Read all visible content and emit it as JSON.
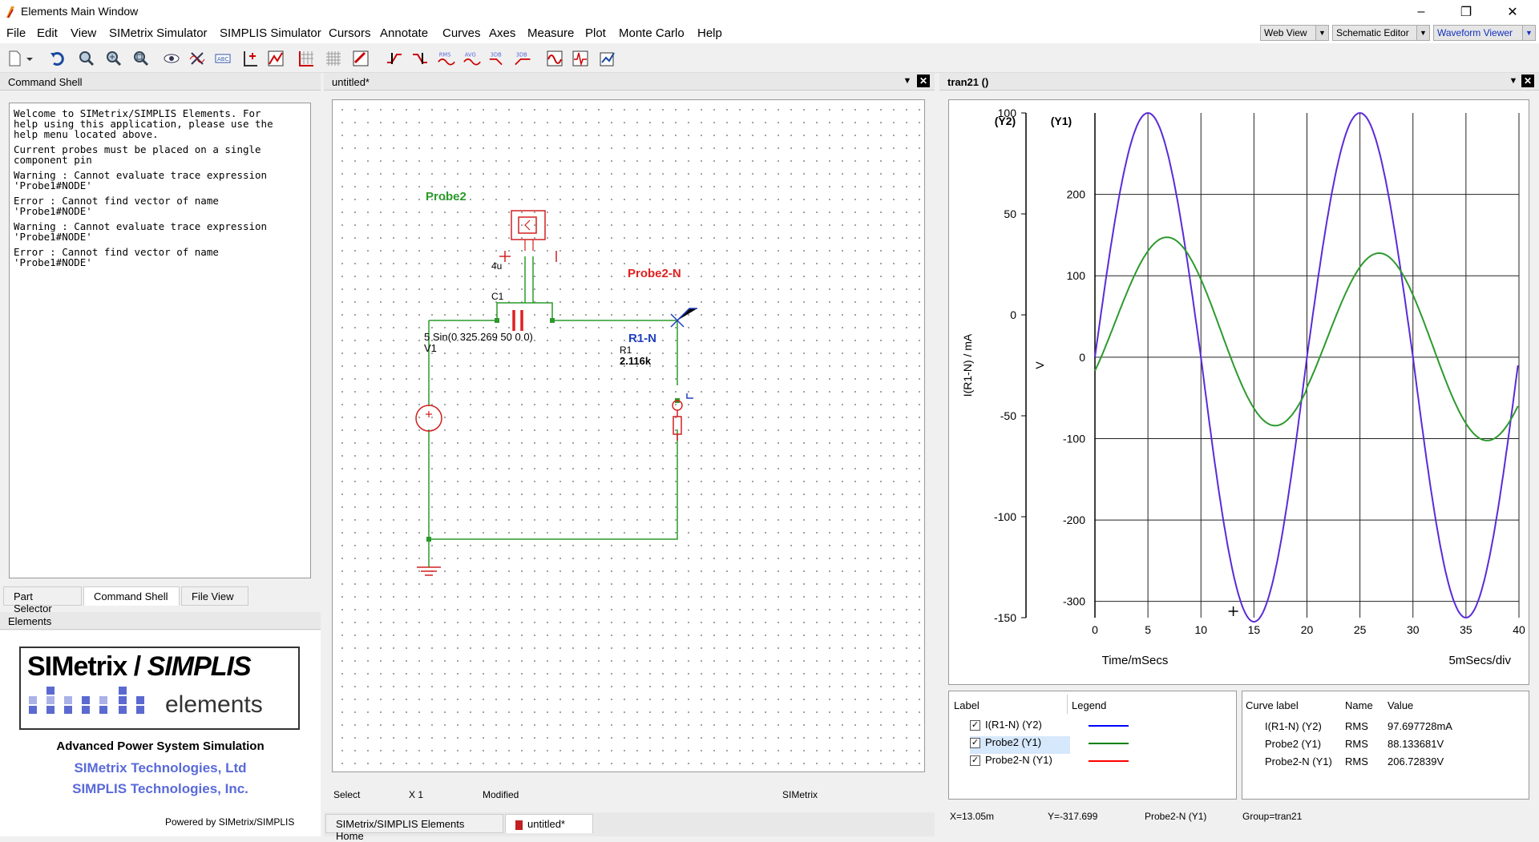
{
  "window": {
    "title": "Elements Main Window",
    "minimize": "–",
    "maximize": "❐",
    "close": "✕"
  },
  "menu": [
    "File",
    "Edit",
    "View",
    "SIMetrix Simulator",
    "SIMPLIS Simulator",
    "Cursors",
    "Annotate",
    "Curves",
    "Axes",
    "Measure",
    "Plot",
    "Monte Carlo",
    "Help"
  ],
  "view_buttons": {
    "web": "Web View",
    "schematic": "Schematic Editor",
    "waveform": "Waveform Viewer"
  },
  "toolbar_icons": [
    "new-icon",
    "undo-icon",
    "zoom-fit-icon",
    "zoom-in-icon",
    "zoom-box-icon",
    "probe-eye-icon",
    "delete-curve-icon",
    "label-icon",
    "add-axis-icon",
    "new-graph-icon",
    "grid-icon",
    "grid-fine-icon",
    "edit-graph-icon",
    "cursor-rise-icon",
    "cursor-fall-icon",
    "rms-icon",
    "avg-icon",
    "3db-icon",
    "3db-low-icon",
    "fft-icon",
    "measure-icon",
    "export-icon"
  ],
  "toolbar_text": {
    "rms": "RMS",
    "avg": "AVG",
    "db1": "3DB",
    "db2": "3DB"
  },
  "command_shell": {
    "header": "Command Shell",
    "lines": [
      "Welcome to SIMetrix/SIMPLIS Elements. For",
      "help using this application, please use the",
      "help menu located above.",
      "",
      "Current probes must be placed on a single",
      "component pin",
      "",
      "Warning : Cannot evaluate trace expression",
      "'Probe1#NODE'",
      "",
      "Error : Cannot find vector of name",
      "'Probe1#NODE'",
      "",
      "Warning : Cannot evaluate trace expression",
      "'Probe1#NODE'",
      "",
      "Error : Cannot find vector of name",
      "'Probe1#NODE'"
    ],
    "tabs": [
      "Part Selector",
      "Command Shell",
      "File View"
    ]
  },
  "elements_panel": {
    "header": "Elements",
    "logo_top_left": "SIMetrix",
    "logo_slash": "/",
    "logo_top_right": "SIMPLIS",
    "logo_sub": "elements",
    "tagline": "Advanced Power System Simulation",
    "company1": "SIMetrix Technologies, Ltd",
    "company2": "SIMPLIS Technologies, Inc.",
    "powered": "Powered by SIMetrix/SIMPLIS"
  },
  "schematic": {
    "tab_title": "untitled*",
    "probe2": "Probe2",
    "c_value": "4u",
    "c_name": "C1",
    "probe2n": "Probe2-N",
    "source_expr": "5 Sin(0 325.269 50 0 0)",
    "source_name": "V1",
    "r1n": "R1-N",
    "r_name": "R1",
    "r_value": "2.116k",
    "status": {
      "mode": "Select",
      "zoom": "X 1",
      "state": "Modified",
      "sim": "SIMetrix"
    },
    "bottom_tabs": [
      "SIMetrix/SIMPLIS Elements Home",
      "untitled*"
    ]
  },
  "graph": {
    "tab_title": "tran21 ()",
    "status": {
      "x": "X=13.05m",
      "y": "Y=-317.699",
      "curve": "Probe2-N (Y1)",
      "group": "Group=tran21"
    },
    "legend_headers": {
      "label": "Label",
      "legend": "Legend"
    },
    "legend": [
      {
        "label": "I(R1-N) (Y2)",
        "color": "#0000ff"
      },
      {
        "label": "Probe2 (Y1)",
        "color": "#008000"
      },
      {
        "label": "Probe2-N (Y1)",
        "color": "#ff0000"
      }
    ],
    "meas_headers": {
      "curve": "Curve label",
      "name": "Name",
      "value": "Value"
    },
    "measurements": [
      {
        "curve": "I(R1-N) (Y2)",
        "name": "RMS",
        "value": "97.697728mA"
      },
      {
        "curve": "Probe2 (Y1)",
        "name": "RMS",
        "value": "88.133681V"
      },
      {
        "curve": "Probe2-N (Y1)",
        "name": "RMS",
        "value": "206.72839V"
      }
    ]
  },
  "chart_data": {
    "type": "line",
    "xlabel": "Time/mSecs",
    "xdiv_label": "5mSecs/div",
    "xlim": [
      0,
      40
    ],
    "xticks": [
      0,
      5,
      10,
      15,
      20,
      25,
      30,
      35,
      40
    ],
    "y1": {
      "title": "(Y1)",
      "label": "V",
      "lim": [
        -320,
        300
      ],
      "ticks": [
        -300,
        -200,
        -100,
        0,
        100,
        200
      ]
    },
    "y2": {
      "title": "(Y2)",
      "label": "I(R1-N) / mA",
      "lim": [
        -150,
        100
      ],
      "ticks": [
        -150,
        -100,
        -50,
        0,
        50,
        100
      ]
    },
    "series": [
      {
        "name": "I(R1-N) (Y2)",
        "axis": "y1",
        "color": "#5b2bd6",
        "amplitude": 300,
        "freq_hz": 50,
        "phase_deg": 0,
        "note_values": "purple trace, peaks ~+300 at 4ms and 24ms, trough ~-325 at 14ms"
      },
      {
        "name": "Probe2 (Y1)",
        "axis": "y1",
        "color": "#2e9a2e",
        "amplitude": 150,
        "freq_hz": 50,
        "phase_deg": -60,
        "note_values": "green trace, peak ~+152 at 8.5ms, trough ~-100 at 19ms, peak ~+115 at 28.5ms"
      }
    ]
  }
}
